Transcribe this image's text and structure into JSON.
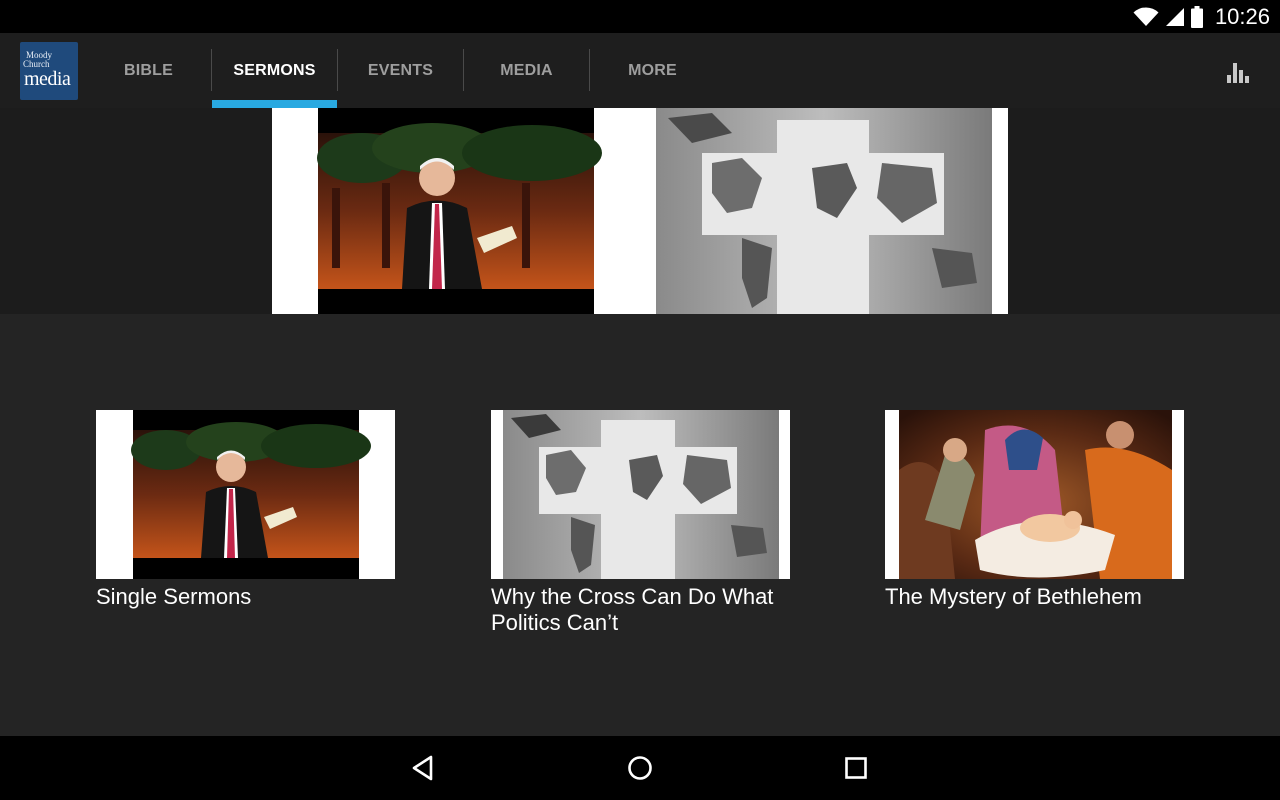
{
  "status": {
    "time": "10:26"
  },
  "app": {
    "logo": {
      "line1": "Moody",
      "line2": "Church",
      "line3": "media"
    }
  },
  "tabs": [
    {
      "label": "BIBLE",
      "active": false
    },
    {
      "label": "SERMONS",
      "active": true
    },
    {
      "label": "EVENTS",
      "active": false
    },
    {
      "label": "MEDIA",
      "active": false
    },
    {
      "label": "MORE",
      "active": false
    }
  ],
  "colors": {
    "accent": "#29a9e1",
    "background": "#242424",
    "appbar": "#1e1e1e"
  },
  "cards": [
    {
      "title": "Single Sermons",
      "thumb": "preacher-at-pulpit"
    },
    {
      "title": "Why the Cross Can Do What Politics Can’t",
      "thumb": "cross-world-map"
    },
    {
      "title": "The Mystery of Bethlehem",
      "thumb": "nativity-painting"
    }
  ],
  "icons": {
    "toolbar": "bar-chart-icon",
    "nav": [
      "back-icon",
      "home-icon",
      "recents-icon"
    ]
  }
}
